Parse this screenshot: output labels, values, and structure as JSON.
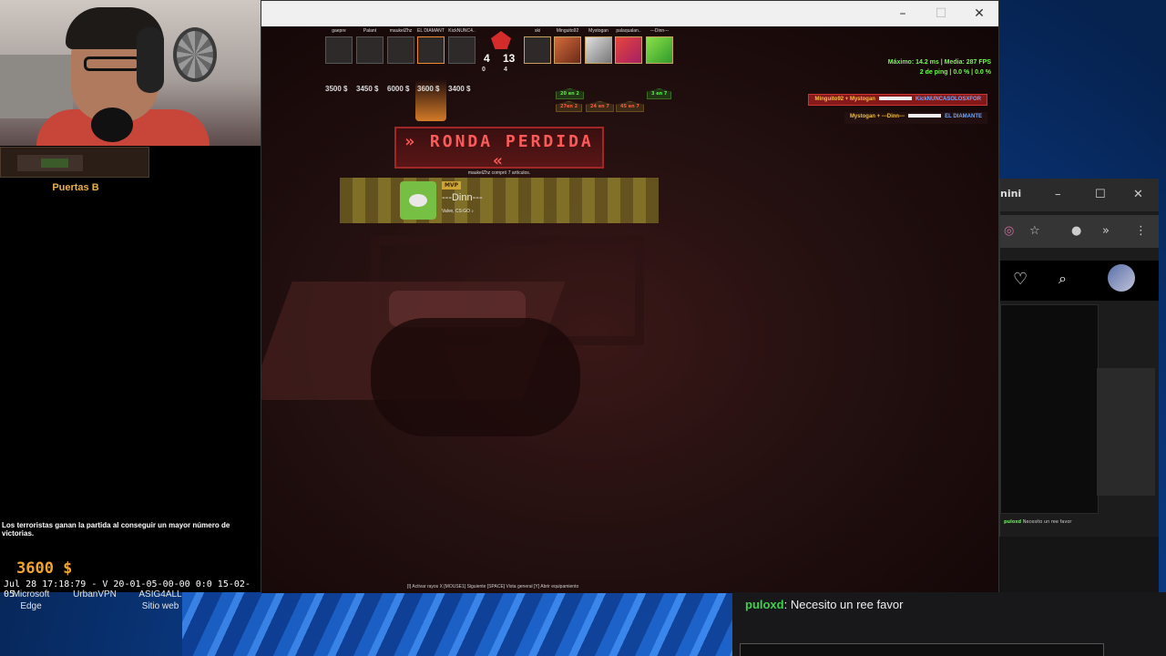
{
  "colors": {
    "accent_orange": "#f4a62a",
    "lost_red": "#ff5a5a",
    "ok_green": "#6aff4a"
  },
  "stream": {
    "location": "Puertas B",
    "killfeed_message": "Los terroristas ganan la partida al conseguir un mayor número de victorias.",
    "money": "3600 $",
    "timestamp": "Jul 28 17:18:79 - V 20-01-05-00-00 0:0 15-02-05"
  },
  "desktop_icons": [
    {
      "label": "Microsoft Edge"
    },
    {
      "label": "UrbanVPN"
    },
    {
      "label": "ASIG4ALL Sitio web"
    }
  ],
  "window": {
    "minimize": "–",
    "maximize": "☐",
    "close": "✕"
  },
  "scoreboard": {
    "ct_players": [
      {
        "name": "gaepre",
        "money": "3500 $"
      },
      {
        "name": "Palant",
        "money": "3450 $"
      },
      {
        "name": "maukelZhz",
        "money": "6000 $"
      },
      {
        "name": "EL DIAMANTE",
        "money": "3600 $"
      },
      {
        "name": "KickNUNC4..",
        "money": "3400 $"
      }
    ],
    "t_players": [
      {
        "name": "ski"
      },
      {
        "name": "Minguito92"
      },
      {
        "name": "Mystogan"
      },
      {
        "name": "palaqualan.."
      },
      {
        "name": "---Dinn---"
      }
    ],
    "ct_score": "4",
    "t_score": "13",
    "ct_alive": "0",
    "t_alive": "4",
    "badges": [
      "20 en 2",
      "27en 2",
      "24 en 7",
      "45 en 7",
      "3 en 7"
    ]
  },
  "round": {
    "title": "» RONDA PERDIDA «",
    "subtitle": "maukelZhz compró 7 artículos."
  },
  "mvp": {
    "tag": "MVP",
    "name": "---Dinn---",
    "music": "Valve, CS:GO ♪"
  },
  "perf": {
    "line1": "Máximo: 14.2 ms | Media: 287 FPS",
    "line2": "2 de ping  | 0.0 %  | 0.0 %"
  },
  "killfeed": [
    {
      "attacker": "Minguito92 + Mystogan",
      "victim": "KickNUNCASOLOSXFOR"
    },
    {
      "attacker": "Mystogan + ---Dinn---",
      "victim": "EL DIAMANTE"
    }
  ],
  "hints": "[I] Activar rayos X   [MOUSE1] Siguiente   [SPACE] Vista general   [Y] Abrir equipamiento",
  "browser": {
    "tab_label": "nini",
    "chat_preview_user": "puloxd",
    "chat_preview_text": "Necesito un ree favor"
  },
  "chat": {
    "user": "puloxd",
    "text": "Necesito un ree favor"
  }
}
